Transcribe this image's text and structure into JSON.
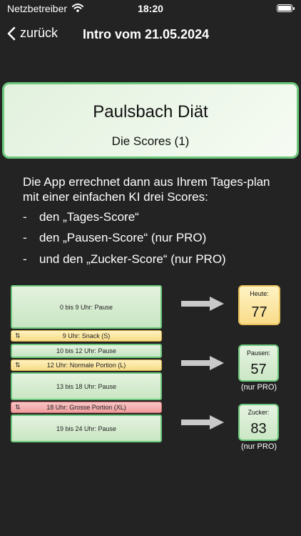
{
  "status_bar": {
    "carrier": "Netzbetreiber",
    "time": "18:20"
  },
  "nav": {
    "back_label": "zurück",
    "title": "Intro vom 21.05.2024"
  },
  "title_card": {
    "title": "Paulsbach Diät",
    "subtitle": "Die Scores (1)"
  },
  "intro_text": "Die App errechnet dann aus Ihrem Tages-plan mit einer einfachen KI drei Scores:",
  "bullets": [
    {
      "dash": "-",
      "text": "den „Tages-Score“"
    },
    {
      "dash": "-",
      "text": "den „Pausen-Score“ (nur PRO)"
    },
    {
      "dash": "-",
      "text": "und den „Zucker-Score“ (nur PRO)"
    }
  ],
  "plan": [
    {
      "label": "0 bis 9 Uhr: Pause",
      "kind": "pause"
    },
    {
      "label": "9 Uhr: Snack (S)",
      "kind": "meal-yellow",
      "icon": "⇅"
    },
    {
      "label": "10 bis 12 Uhr: Pause",
      "kind": "pause"
    },
    {
      "label": "12 Uhr: Normale Portion (L)",
      "kind": "meal-yellow",
      "icon": "⇅"
    },
    {
      "label": "13 bis 18 Uhr: Pause",
      "kind": "pause"
    },
    {
      "label": "18 Uhr: Grosse Portion (XL)",
      "kind": "meal-red",
      "icon": "⇅"
    },
    {
      "label": "19 bis 24 Uhr: Pause",
      "kind": "pause"
    }
  ],
  "scores": {
    "today": {
      "label": "Heute:",
      "value": "77"
    },
    "pause": {
      "label": "Pausen:",
      "value": "57",
      "note": "(nur PRO)"
    },
    "sugar": {
      "label": "Zucker:",
      "value": "83",
      "note": "(nur PRO)"
    }
  },
  "colors": {
    "background": "#232323",
    "green_border": "#6cc77c",
    "yellow": "#f6dc85",
    "red": "#ef9d9d"
  }
}
